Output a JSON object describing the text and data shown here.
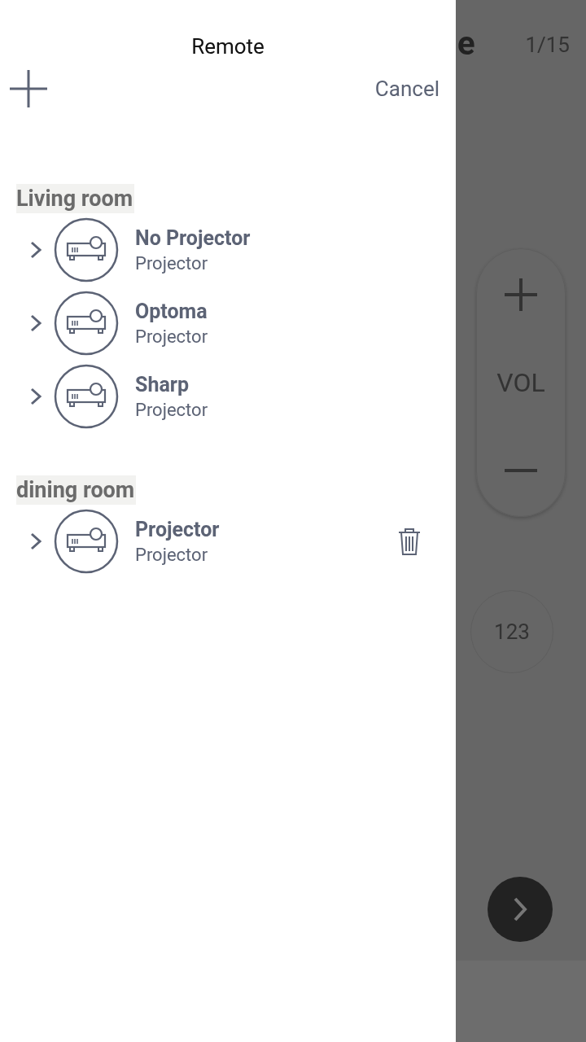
{
  "drawer": {
    "title": "Remote",
    "cancel": "Cancel",
    "groups": [
      {
        "name": "Living room",
        "devices": [
          {
            "name": "No Projector",
            "type": "Projector",
            "show_delete": false
          },
          {
            "name": "Optoma",
            "type": "Projector",
            "show_delete": false
          },
          {
            "name": "Sharp",
            "type": "Projector",
            "show_delete": false
          }
        ]
      },
      {
        "name": "dining room",
        "devices": [
          {
            "name": "Projector",
            "type": "Projector",
            "show_delete": true
          }
        ]
      }
    ]
  },
  "background": {
    "title_fragment": "e",
    "page_counter": "1/15",
    "volume_label": "VOL",
    "numpad_label": "123"
  }
}
